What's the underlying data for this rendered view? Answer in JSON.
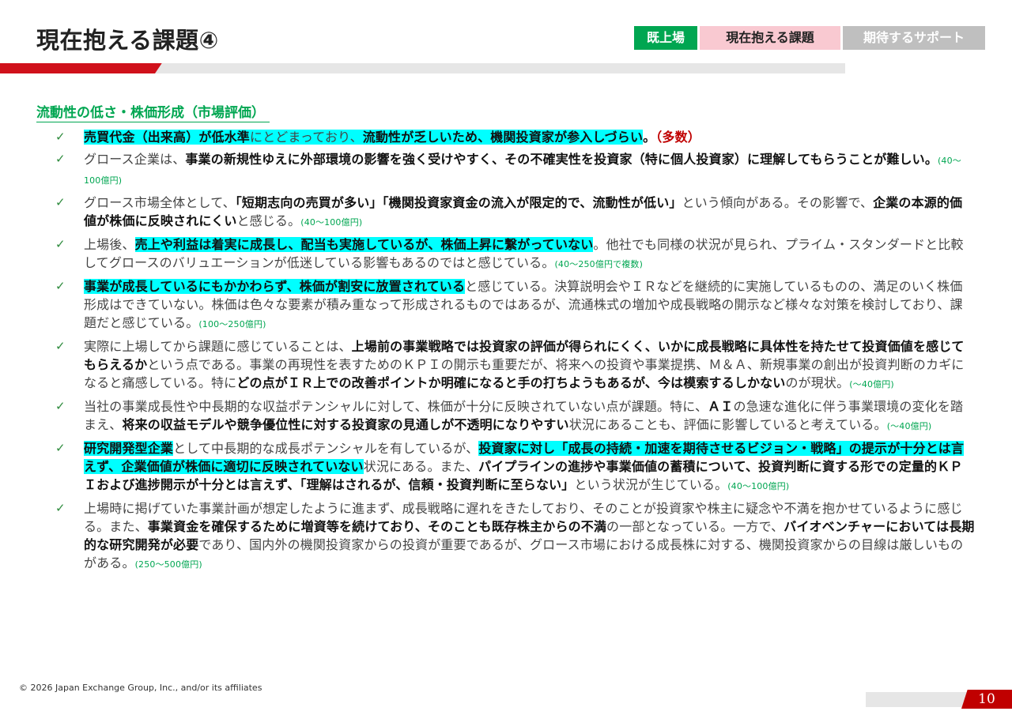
{
  "header": {
    "title": "現在抱える課題④",
    "tabs": [
      "既上場",
      "現在抱える課題",
      "期待するサポート"
    ]
  },
  "section_title": "流動性の低さ・株価形成（市場評価）",
  "check_symbol": "✓",
  "items": [
    {
      "segments": [
        {
          "t": "売買代金（出来高）が低水準",
          "b": true,
          "h": true
        },
        {
          "t": "にとどまっており、",
          "h": true
        },
        {
          "t": "流動性が乏しいため、機関投資家が参入しづらい",
          "b": true,
          "h": true
        },
        {
          "t": "。",
          "b": true
        },
        {
          "t": "（多数）",
          "r": true
        }
      ]
    },
    {
      "segments": [
        {
          "t": "グロース企業は、"
        },
        {
          "t": "事業の新規性ゆえに外部環境の影響を強く受けやすく、その不確実性を投資家（特に個人投資家）に理解してもらうことが難しい。",
          "b": true
        },
        {
          "t": "(40～100億円)",
          "n": true
        }
      ]
    },
    {
      "segments": [
        {
          "t": "グロース市場全体として、"
        },
        {
          "t": "「短期志向の売買が多い」「機関投資家資金の流入が限定的で、流動性が低い」",
          "b": true
        },
        {
          "t": "という傾向がある。その影響で、"
        },
        {
          "t": "企業の本源的価値が株価に反映されにくい",
          "b": true
        },
        {
          "t": "と感じる。"
        },
        {
          "t": "(40～100億円)",
          "n": true
        }
      ]
    },
    {
      "segments": [
        {
          "t": "上場後、"
        },
        {
          "t": "売上や利益は着実に成長し、配当も実施しているが、株価上昇に繋がっていない",
          "b": true,
          "h": true
        },
        {
          "t": "。他社でも同様の状況が見られ、プライム・スタンダードと比較してグロースのバリュエーションが低迷している影響もあるのではと感じている。"
        },
        {
          "t": "(40～250億円で複数)",
          "n": true
        }
      ]
    },
    {
      "segments": [
        {
          "t": "事業が成長しているにもかかわらず、株価が割安に放置されている",
          "b": true,
          "h": true
        },
        {
          "t": "と感じている。決算説明会やＩＲなどを継続的に実施しているものの、満足のいく株価形成はできていない。株価は色々な要素が積み重なって形成されるものではあるが、流通株式の増加や成長戦略の開示など様々な対策を検討しており、課題だと感じている。"
        },
        {
          "t": "(100～250億円)",
          "n": true
        }
      ]
    },
    {
      "segments": [
        {
          "t": "実際に上場してから課題に感じていることは、"
        },
        {
          "t": "上場前の事業戦略では投資家の評価が得られにくく、いかに成長戦略に具体性を持たせて投資価値を感じてもらえるか",
          "b": true
        },
        {
          "t": "という点である。事業の再現性を表すためのＫＰＩの開示も重要だが、将来への投資や事業提携、Ｍ＆Ａ、新規事業の創出が投資判断のカギになると痛感している。特に"
        },
        {
          "t": "どの点がＩＲ上での改善ポイントか明確になると手の打ちようもあるが、今は模索するしかない",
          "b": true
        },
        {
          "t": "のが現状。"
        },
        {
          "t": "(～40億円)",
          "n": true
        }
      ]
    },
    {
      "segments": [
        {
          "t": "当社の事業成長性や中長期的な収益ポテンシャルに対して、株価が十分に反映されていない点が課題。特に、"
        },
        {
          "t": "ＡＩ",
          "b": true
        },
        {
          "t": "の急速な進化に伴う事業環境の変化を踏まえ、"
        },
        {
          "t": "将来の収益モデルや競争優位性に対する投資家の見通しが不透明になりやすい",
          "b": true
        },
        {
          "t": "状況にあることも、評価に影響していると考えている。"
        },
        {
          "t": "(～40億円)",
          "n": true
        }
      ]
    },
    {
      "segments": [
        {
          "t": "研究開発型企業",
          "b": true,
          "h": true
        },
        {
          "t": "として中長期的な成長ポテンシャルを有しているが、"
        },
        {
          "t": "投資家に対し「成長の持続・加速を期待させるビジョン・戦略」の提示が十分とは言えず、企業価値が株価に適切に反映されていない",
          "b": true,
          "h": true
        },
        {
          "t": "状況にある。また、"
        },
        {
          "t": "パイプラインの進捗や事業価値の蓄積について、投資判断に資する形での定量的ＫＰＩおよび進捗開示が十分とは言えず、「理解はされるが、信頼・投資判断に至らない」",
          "b": true
        },
        {
          "t": "という状況が生じている。"
        },
        {
          "t": "(40～100億円)",
          "n": true
        }
      ]
    },
    {
      "segments": [
        {
          "t": "上場時に掲げていた事業計画が想定したように進まず、成長戦略に遅れをきたしており、そのことが投資家や株主に疑念や不満を抱かせているように感じる。また、"
        },
        {
          "t": "事業資金を確保するために増資等を続けており、そのことも既存株主からの不満",
          "b": true
        },
        {
          "t": "の一部となっている。一方で、"
        },
        {
          "t": "バイオベンチャーにおいては長期的な研究開発が必要",
          "b": true
        },
        {
          "t": "であり、国内外の機関投資家からの投資が重要であるが、グロース市場における成長株に対する、機関投資家からの目線は厳しいものがある。"
        },
        {
          "t": "(250～500億円)",
          "n": true
        }
      ]
    }
  ],
  "footer": {
    "copyright": "© 2026 Japan Exchange Group, Inc., and/or its affiliates",
    "page_number": "10"
  },
  "colors": {
    "accent_red": "#d0111b",
    "accent_green": "#00a651",
    "highlight": "#00ffff",
    "tab_pink": "#f9c9d1",
    "tab_gray": "#bfbfbf"
  }
}
